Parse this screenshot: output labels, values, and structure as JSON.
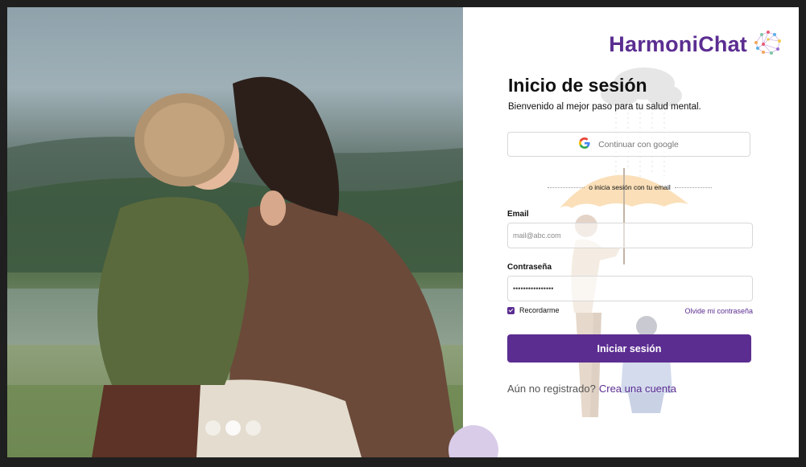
{
  "brand": {
    "name": "HarmoniChat",
    "logo_icon": "brain-network-icon",
    "color": "#5b2d91"
  },
  "carousel": {
    "slides": 3,
    "active_index": 1
  },
  "login": {
    "title": "Inicio de sesión",
    "subtitle": "Bienvenido al mejor paso para tu salud mental.",
    "google_button": "Continuar con google",
    "divider_text": "o inicia sesión con tu email",
    "email_label": "Email",
    "email_placeholder": "mail@abc.com",
    "password_label": "Contraseña",
    "password_value": "••••••••••••••••",
    "remember_label": "Recordarme",
    "remember_checked": true,
    "forgot_link": "Olvide mi contraseña",
    "submit_button": "Iniciar sesión",
    "register_prompt": "Aún no registrado?",
    "register_link": "Crea una cuenta"
  },
  "colors": {
    "accent": "#5b2d91",
    "background": "#ffffff"
  }
}
